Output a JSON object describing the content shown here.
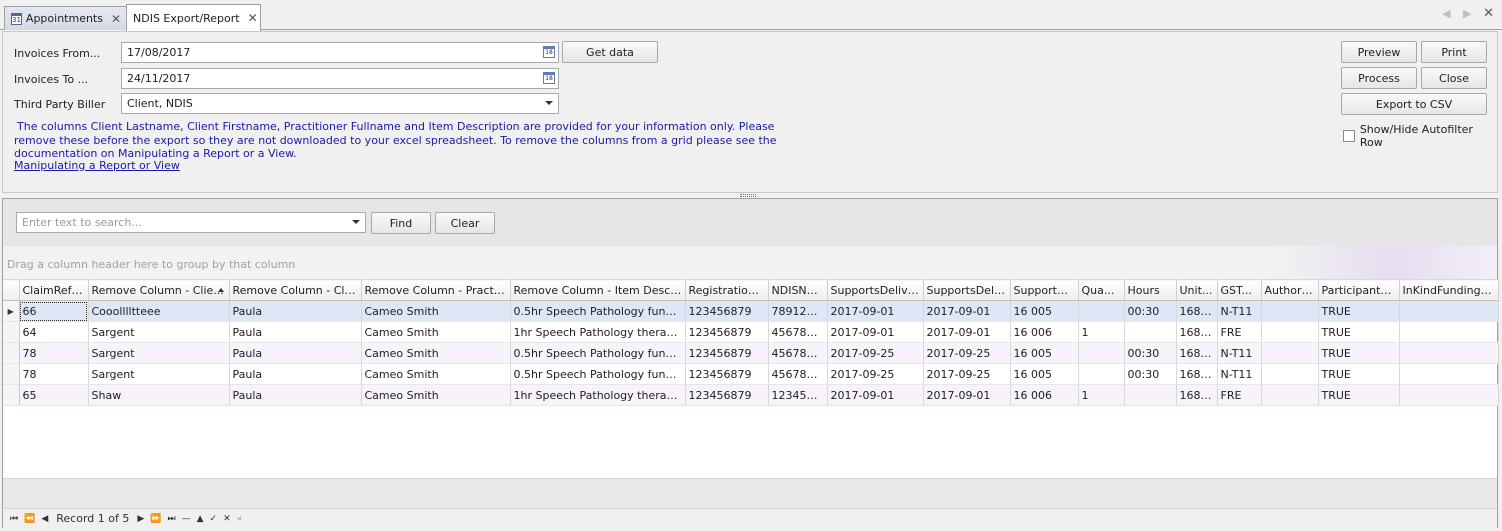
{
  "tabs": [
    {
      "label": "Appointments",
      "calendar_day": "31"
    },
    {
      "label": "NDIS Export/Report"
    }
  ],
  "filters": {
    "invoices_from_label": "Invoices From...",
    "invoices_from_value": "17/08/2017",
    "invoices_to_label": "Invoices To ...",
    "invoices_to_value": "24/11/2017",
    "third_party_label": "Third Party Biller",
    "third_party_value": "Client, NDIS",
    "get_data_label": "Get data"
  },
  "info": {
    "line1": "The columns Client Lastname, Client Firstname, Practitioner Fullname and Item Description are provided for your information only. Please",
    "line2": "remove these before the export so they are not downloaded to your excel spreadsheet. To remove the columns from a grid please see the",
    "line3": "documentation on Manipulating a Report or a View.",
    "link": "Manipulating a Report or View"
  },
  "actions": {
    "preview": "Preview",
    "print": "Print",
    "process": "Process",
    "close": "Close",
    "export_csv": "Export to CSV",
    "autofilter": "Show/Hide Autofilter Row"
  },
  "search": {
    "placeholder": "Enter text to search...",
    "find": "Find",
    "clear": "Clear"
  },
  "group_hint": "Drag a column header here to group by that column",
  "grid": {
    "columns": [
      "ClaimRefe...",
      "Remove Column - Clie...",
      "Remove Column - Clien...",
      "Remove Column - Practitio...",
      "Remove Column - Item Description",
      "Registration...",
      "NDISNu...",
      "SupportsDeliver...",
      "SupportsDeliv...",
      "SupportN...",
      "Qua...",
      "Hours",
      "Unit...",
      "GST...",
      "Authori...",
      "ParticipantA...",
      "InKindFundingPr..."
    ],
    "rows": [
      [
        "66",
        "Cooolllltteee",
        "Paula",
        "Cameo Smith",
        "0.5hr Speech Pathology funded ...",
        "123456879",
        "789123...",
        "2017-09-01",
        "2017-09-01",
        "16 005",
        "",
        "00:30",
        "168.26",
        "N-T11",
        "",
        "TRUE",
        ""
      ],
      [
        "64",
        "Sargent",
        "Paula",
        "Cameo Smith",
        "1hr Speech Pathology therapy s...",
        "123456879",
        "456789...",
        "2017-09-01",
        "2017-09-01",
        "16 006",
        "1",
        "",
        "168.26",
        "FRE",
        "",
        "TRUE",
        ""
      ],
      [
        "78",
        "Sargent",
        "Paula",
        "Cameo Smith",
        "0.5hr Speech Pathology funded ...",
        "123456879",
        "456789...",
        "2017-09-25",
        "2017-09-25",
        "16 005",
        "",
        "00:30",
        "168.26",
        "N-T11",
        "",
        "TRUE",
        ""
      ],
      [
        "78",
        "Sargent",
        "Paula",
        "Cameo Smith",
        "0.5hr Speech Pathology funded ...",
        "123456879",
        "456789...",
        "2017-09-25",
        "2017-09-25",
        "16 005",
        "",
        "00:30",
        "168.26",
        "N-T11",
        "",
        "TRUE",
        ""
      ],
      [
        "65",
        "Shaw",
        "Paula",
        "Cameo Smith",
        "1hr Speech Pathology therapy s...",
        "123456879",
        "123456...",
        "2017-09-01",
        "2017-09-01",
        "16 006",
        "1",
        "",
        "168.26",
        "FRE",
        "",
        "TRUE",
        ""
      ]
    ]
  },
  "navigator": {
    "record_text": "Record 1 of 5"
  }
}
